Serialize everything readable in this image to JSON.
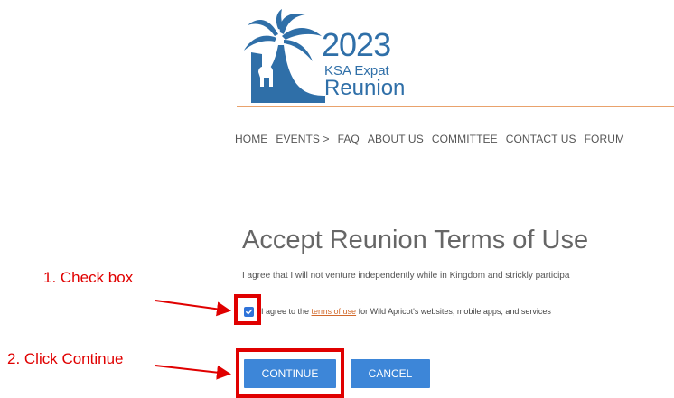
{
  "logo": {
    "year": "2023",
    "line1": "KSA Expat",
    "line2": "Reunion"
  },
  "nav": {
    "items": [
      "HOME",
      "EVENTS >",
      "FAQ",
      "ABOUT US",
      "COMMITTEE",
      "CONTACT US",
      "FORUM"
    ]
  },
  "page": {
    "heading": "Accept Reunion Terms of Use",
    "agreement_text": "I agree that I will not venture independently while in Kingdom and strickly participa",
    "terms_prefix": "I agree to the ",
    "terms_link": "terms of use",
    "terms_suffix": " for Wild Apricot's websites, mobile apps, and services",
    "checkbox_checked": true
  },
  "buttons": {
    "continue": "CONTINUE",
    "cancel": "CANCEL"
  },
  "annotations": {
    "step1": "1. Check box",
    "step2": "2. Click Continue"
  },
  "colors": {
    "brand_blue": "#2F6FA8",
    "button_blue": "#3D86D8",
    "divider_orange": "#E9A26C",
    "link_orange": "#D2692B",
    "annotation_red": "#E00000"
  }
}
